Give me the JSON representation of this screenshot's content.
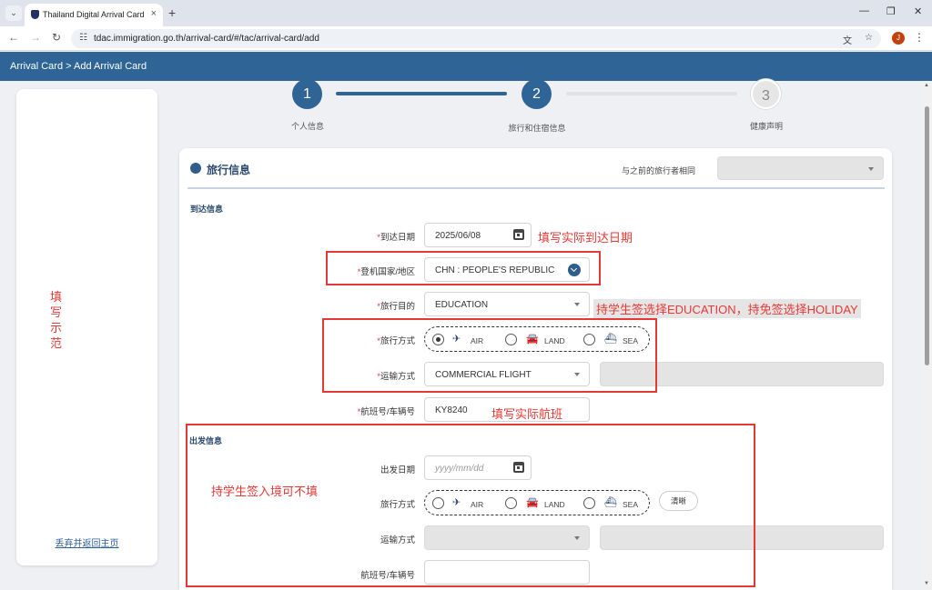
{
  "browser": {
    "tab_title": "Thailand Digital Arrival Card",
    "url": "tdac.immigration.go.th/arrival-card/#/tac/arrival-card/add",
    "avatar_letter": "J"
  },
  "header": {
    "breadcrumb": "Arrival Card > Add Arrival Card"
  },
  "sidebar": {
    "example_label": "填写示范",
    "discard_link": "丢弃并返回主页"
  },
  "steps": [
    {
      "number": "1",
      "label": "个人信息",
      "state": "complete"
    },
    {
      "number": "2",
      "label": "旅行和住宿信息",
      "state": "current"
    },
    {
      "number": "3",
      "label": "健康声明",
      "state": "pending"
    }
  ],
  "card": {
    "title": "旅行信息",
    "same_as_previous_label": "与之前的旅行者相同",
    "same_as_previous_value": ""
  },
  "arrival": {
    "section_title": "到达信息",
    "arrival_date": {
      "label": "到达日期",
      "value": "2025/06/08"
    },
    "boarding_country": {
      "label": "登机国家/地区",
      "value": "CHN : PEOPLE'S REPUBLIC"
    },
    "purpose": {
      "label": "旅行目的",
      "value": "EDUCATION"
    },
    "travel_mode": {
      "label": "旅行方式",
      "options": [
        "AIR",
        "LAND",
        "SEA"
      ],
      "selected": "AIR"
    },
    "transport_mode": {
      "label": "运输方式",
      "value": "COMMERCIAL FLIGHT"
    },
    "flight_no": {
      "label": "航班号/车辆号",
      "value": "KY8240"
    }
  },
  "departure": {
    "section_title": "出发信息",
    "departure_date": {
      "label": "出发日期",
      "placeholder": "yyyy/mm/dd"
    },
    "travel_mode": {
      "label": "旅行方式",
      "options": [
        "AIR",
        "LAND",
        "SEA"
      ],
      "selected": ""
    },
    "clear_button": "清晰",
    "transport_mode": {
      "label": "运输方式",
      "value": ""
    },
    "flight_no": {
      "label": "航班号/车辆号",
      "value": ""
    }
  },
  "annotations": {
    "arrival_date_note": "填写实际到达日期",
    "purpose_note": "持学生签选择EDUCATION，持免签选择HOLIDAY",
    "flight_note": "填写实际航班",
    "departure_note": "持学生签入境可不填"
  },
  "colors": {
    "brand": "#2f6497",
    "annotation": "#e53935"
  }
}
